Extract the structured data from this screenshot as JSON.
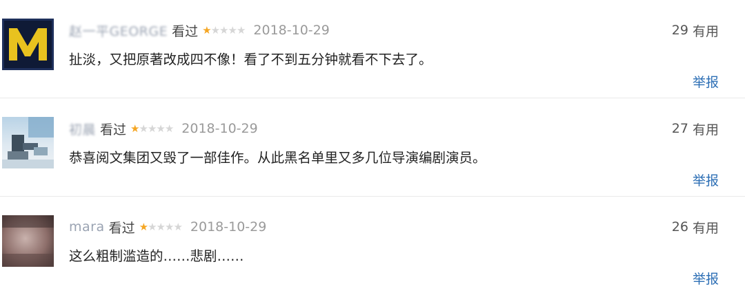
{
  "reviews": [
    {
      "username": "赵一平GEORGE",
      "watched_label": "看过",
      "rating": 1,
      "max_rating": 5,
      "date": "2018-10-29",
      "useful_count": "29",
      "useful_label": "有用",
      "comment": "扯淡，又把原著改成四不像！看了不到五分钟就看不下去了。",
      "report_label": "举报",
      "avatar": "logo-avatar"
    },
    {
      "username": "初晨",
      "watched_label": "看过",
      "rating": 1,
      "max_rating": 5,
      "date": "2018-10-29",
      "useful_count": "27",
      "useful_label": "有用",
      "comment": "恭喜阅文集团又毁了一部佳作。从此黑名单里又多几位导演编剧演员。",
      "report_label": "举报",
      "avatar": "photo-avatar"
    },
    {
      "username": "mara",
      "watched_label": "看过",
      "rating": 1,
      "max_rating": 5,
      "date": "2018-10-29",
      "useful_count": "26",
      "useful_label": "有用",
      "comment": "这么粗制滥造的……悲剧……",
      "report_label": "举报",
      "avatar": "photo-avatar"
    }
  ],
  "colors": {
    "star_on": "#f5a623",
    "star_off": "#d6d6d6",
    "link": "#2d6fb5",
    "divider": "#e9e9e9"
  }
}
